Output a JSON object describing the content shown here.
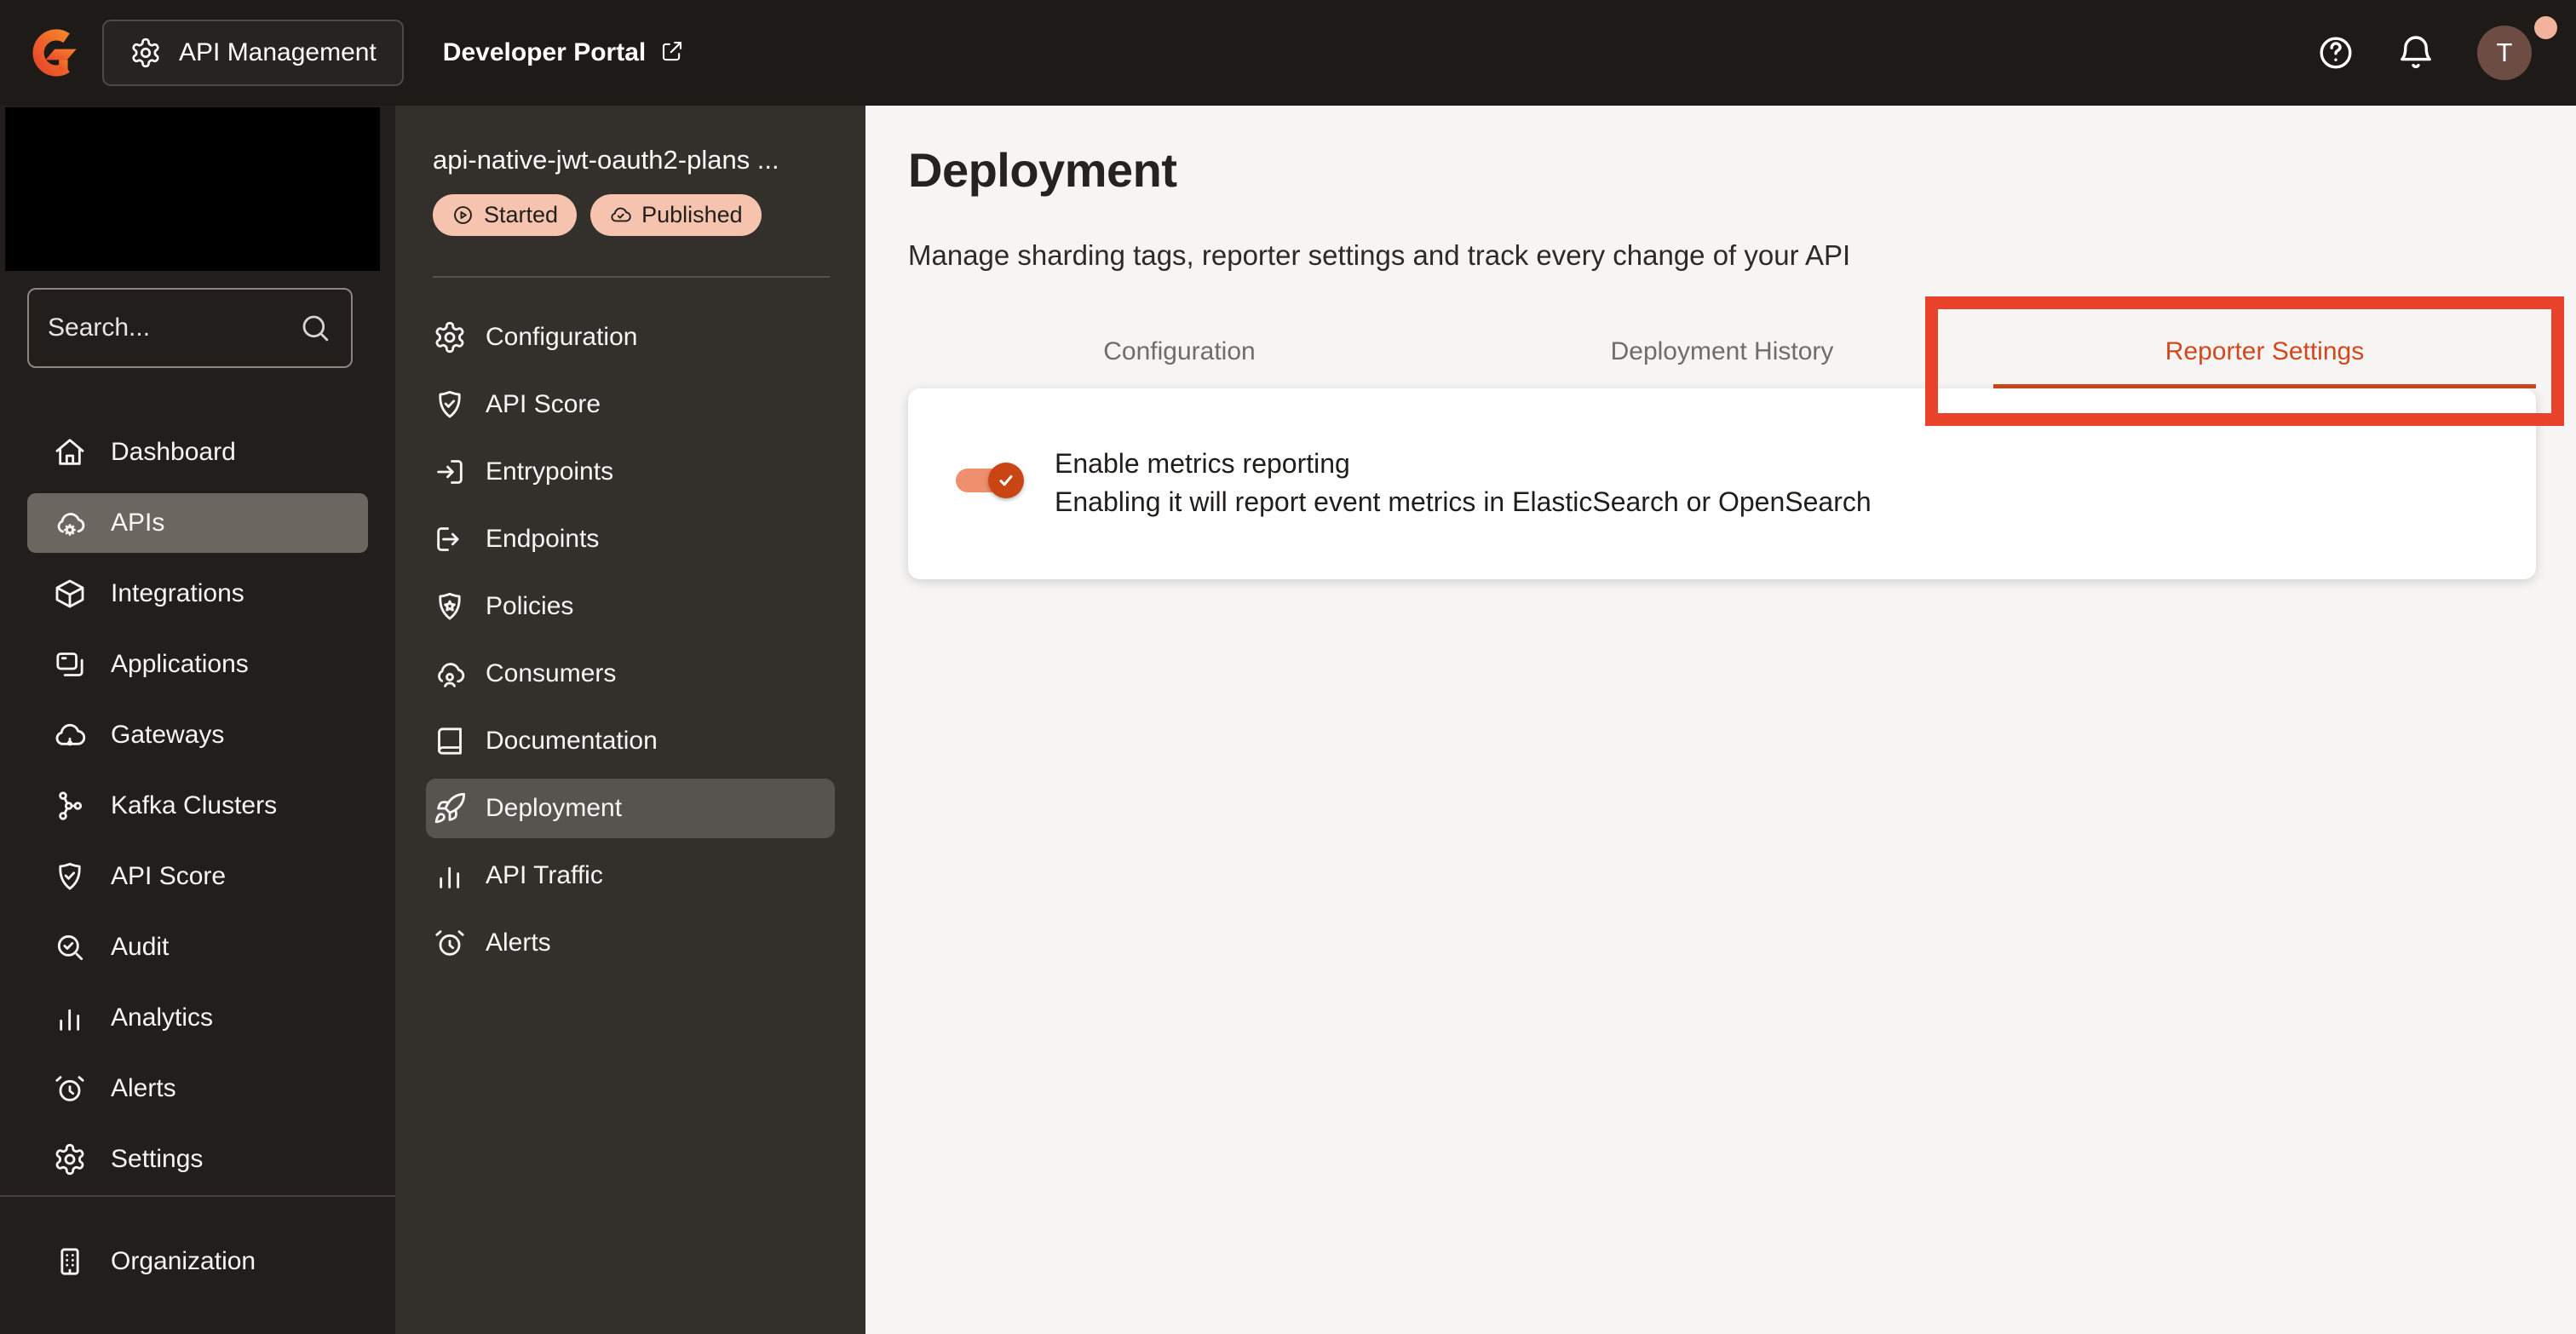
{
  "topbar": {
    "app_switcher_label": "API Management",
    "developer_portal_label": "Developer Portal",
    "avatar_initial": "T"
  },
  "sidebar": {
    "search_placeholder": "Search...",
    "items": [
      {
        "icon": "home",
        "label": "Dashboard"
      },
      {
        "icon": "cloud-cog",
        "label": "APIs",
        "selected": true
      },
      {
        "icon": "cube",
        "label": "Integrations"
      },
      {
        "icon": "stack",
        "label": "Applications"
      },
      {
        "icon": "cloud",
        "label": "Gateways"
      },
      {
        "icon": "kafka",
        "label": "Kafka Clusters"
      },
      {
        "icon": "shield-check",
        "label": "API Score"
      },
      {
        "icon": "search-check",
        "label": "Audit"
      },
      {
        "icon": "bar-chart",
        "label": "Analytics"
      },
      {
        "icon": "alarm-clock",
        "label": "Alerts"
      },
      {
        "icon": "gear",
        "label": "Settings"
      }
    ],
    "footer_items": [
      {
        "icon": "building",
        "label": "Organization"
      }
    ]
  },
  "api_sidebar": {
    "title": "api-native-jwt-oauth2-plans ...",
    "badges": [
      {
        "icon": "play-circle",
        "label": "Started"
      },
      {
        "icon": "cloud-check",
        "label": "Published"
      }
    ],
    "items": [
      {
        "icon": "gear",
        "label": "Configuration"
      },
      {
        "icon": "shield-check",
        "label": "API Score"
      },
      {
        "icon": "arrow-in-box",
        "label": "Entrypoints"
      },
      {
        "icon": "arrow-out-box",
        "label": "Endpoints"
      },
      {
        "icon": "shield-star",
        "label": "Policies"
      },
      {
        "icon": "cloud-user",
        "label": "Consumers"
      },
      {
        "icon": "book",
        "label": "Documentation"
      },
      {
        "icon": "rocket",
        "label": "Deployment",
        "selected": true
      },
      {
        "icon": "bar-chart",
        "label": "API Traffic"
      },
      {
        "icon": "alarm-clock",
        "label": "Alerts"
      }
    ]
  },
  "main": {
    "title": "Deployment",
    "subtitle": "Manage sharding tags, reporter settings and track every change of your API",
    "tabs": [
      {
        "label": "Configuration"
      },
      {
        "label": "Deployment History"
      },
      {
        "label": "Reporter Settings",
        "active": true
      }
    ],
    "reporter_card": {
      "toggle_on": true,
      "title": "Enable metrics reporting",
      "description": "Enabling it will report event metrics in ElasticSearch or OpenSearch"
    },
    "annotation_target": "Reporter Settings"
  },
  "colors": {
    "accent": "#d0481c",
    "tab_indicator": "#c94a1d",
    "annotation_red": "#e8432a",
    "badge_bg": "#f6c3ae",
    "toggle_track": "#ef8f6d",
    "toggle_thumb": "#c94614",
    "avatar_bg": "#6d4c43",
    "avatar_dot": "#f3b29b"
  }
}
